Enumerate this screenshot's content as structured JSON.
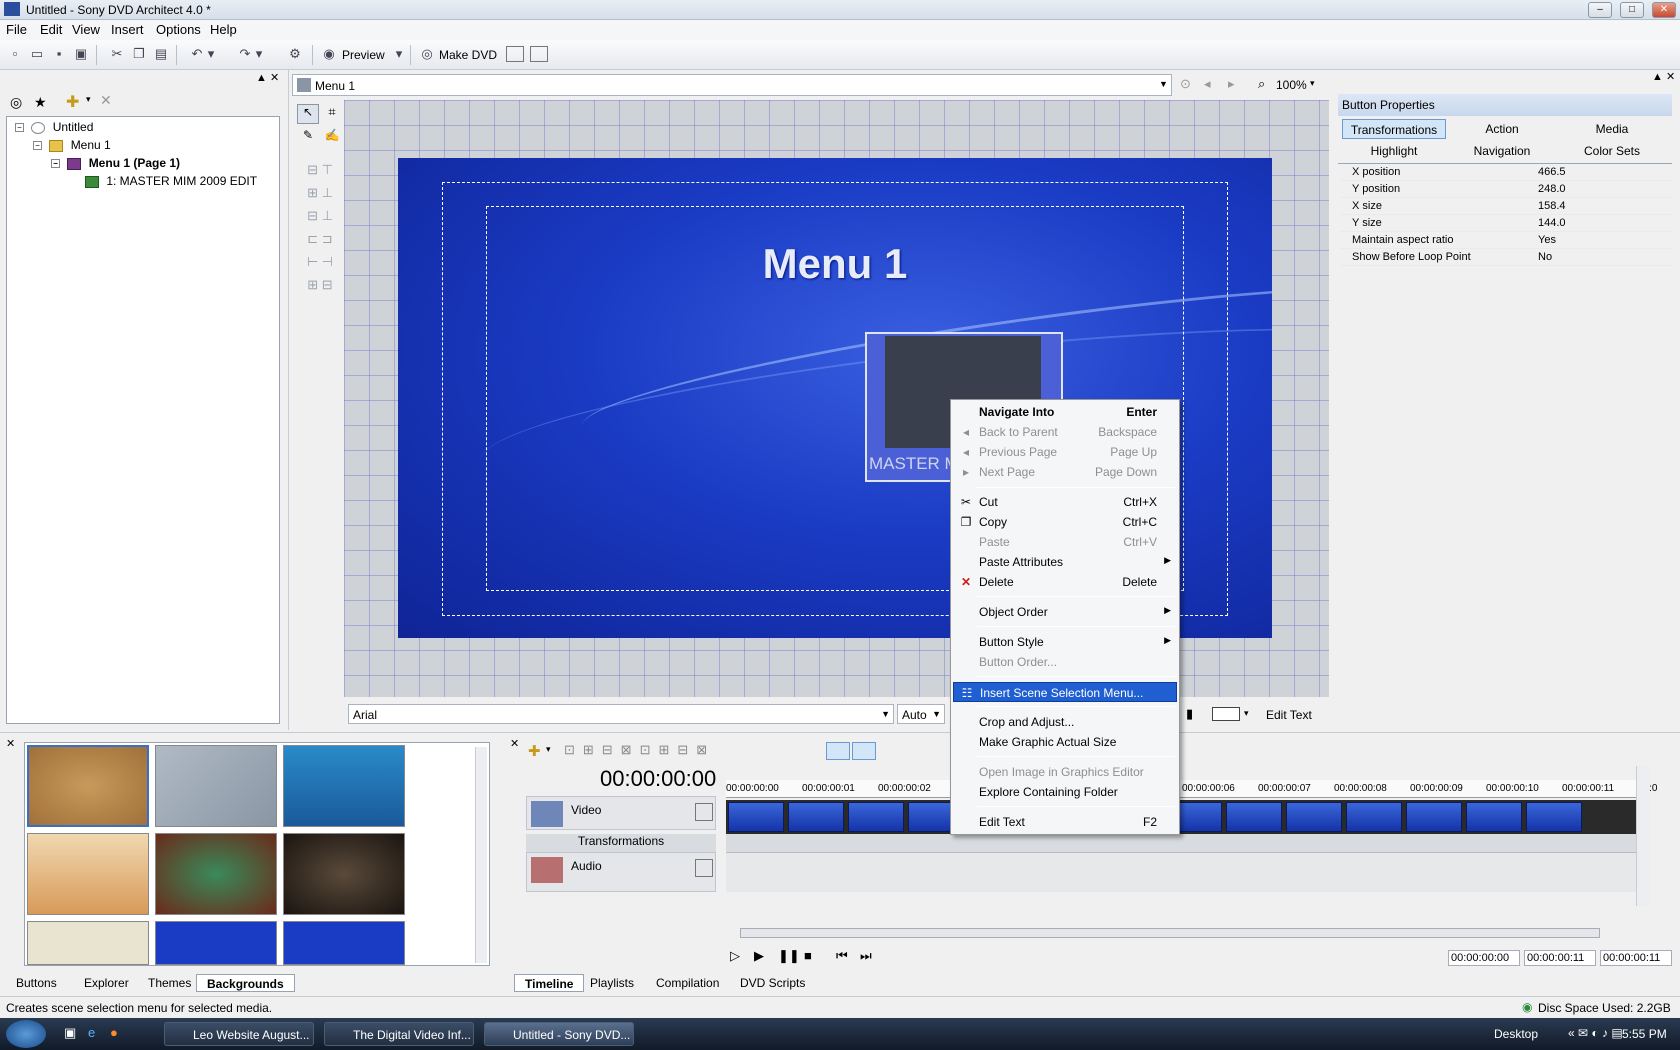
{
  "window": {
    "title": "Untitled - Sony DVD Architect 4.0 *",
    "min": "–",
    "max": "□",
    "close": "✕"
  },
  "menubar": [
    "File",
    "Edit",
    "View",
    "Insert",
    "Options",
    "Help"
  ],
  "toolbar": {
    "preview_label": "Preview",
    "make_dvd_label": "Make DVD"
  },
  "project_tree": {
    "root": "Untitled",
    "menu": "Menu 1",
    "page": "Menu 1 (Page 1)",
    "item": "1: MASTER MIM 2009 EDIT"
  },
  "canvas": {
    "menu_selector": "Menu 1",
    "zoom": "100%",
    "menu_title": "Menu 1",
    "button_label": "MASTER M",
    "font_name": "Arial",
    "font_size": "Auto",
    "edit_text_label": "Edit Text"
  },
  "button_properties": {
    "header": "Button Properties",
    "tabs_row1": [
      "Transformations",
      "Action",
      "Media"
    ],
    "tabs_row2": [
      "Highlight",
      "Navigation",
      "Color Sets"
    ],
    "rows": [
      {
        "name": "X position",
        "value": "466.5"
      },
      {
        "name": "Y position",
        "value": "248.0"
      },
      {
        "name": "X size",
        "value": "158.4"
      },
      {
        "name": "Y size",
        "value": "144.0"
      },
      {
        "name": "Maintain aspect ratio",
        "value": "Yes"
      },
      {
        "name": "Show Before Loop Point",
        "value": "No"
      }
    ]
  },
  "context_menu": {
    "items": [
      {
        "label": "Navigate Into",
        "shortcut": "Enter",
        "disabled": false,
        "bold": true
      },
      {
        "label": "Back to Parent",
        "shortcut": "Backspace",
        "disabled": true
      },
      {
        "label": "Previous Page",
        "shortcut": "Page Up",
        "disabled": true
      },
      {
        "label": "Next Page",
        "shortcut": "Page Down",
        "disabled": true
      },
      {
        "label": "Cut",
        "shortcut": "Ctrl+X",
        "disabled": false
      },
      {
        "label": "Copy",
        "shortcut": "Ctrl+C",
        "disabled": false
      },
      {
        "label": "Paste",
        "shortcut": "Ctrl+V",
        "disabled": true
      },
      {
        "label": "Paste Attributes",
        "shortcut": "",
        "disabled": false
      },
      {
        "label": "Delete",
        "shortcut": "Delete",
        "disabled": false
      },
      {
        "label": "Object Order",
        "shortcut": "",
        "disabled": false
      },
      {
        "label": "Button Style",
        "shortcut": "",
        "disabled": false
      },
      {
        "label": "Button Order...",
        "shortcut": "",
        "disabled": true
      },
      {
        "label": "Insert Scene Selection Menu...",
        "shortcut": "",
        "disabled": false
      },
      {
        "label": "Crop and Adjust...",
        "shortcut": "",
        "disabled": false
      },
      {
        "label": "Make Graphic Actual Size",
        "shortcut": "",
        "disabled": false
      },
      {
        "label": "Open Image in Graphics Editor",
        "shortcut": "",
        "disabled": true
      },
      {
        "label": "Explore Containing Folder",
        "shortcut": "",
        "disabled": false
      },
      {
        "label": "Edit Text",
        "shortcut": "F2",
        "disabled": false
      }
    ]
  },
  "bottom_tabs": [
    "Buttons",
    "Explorer",
    "Themes",
    "Backgrounds"
  ],
  "timeline": {
    "timecode": "00:00:00:00",
    "video_track": "Video",
    "transformations": "Transformations",
    "audio_track": "Audio",
    "ruler": [
      "00:00:00:00",
      "00:00:00:01",
      "00:00:00:02",
      "00:00:00:06",
      "00:00:00:07",
      "00:00:00:08",
      "00:00:00:09",
      "00:00:00:10",
      "00:00:00:11",
      "00:0"
    ],
    "time_start": "00:00:00:00",
    "time_end": "00:00:00:11",
    "time_length": "00:00:00:11",
    "tabs": [
      "Timeline",
      "Playlists",
      "Compilation",
      "DVD Scripts"
    ]
  },
  "status": {
    "message": "Creates scene selection menu for selected media.",
    "disc_space": "Disc Space Used: 2.2GB"
  },
  "taskbar": {
    "tasks": [
      "Leo Website August...",
      "The Digital Video Inf...",
      "Untitled - Sony DVD..."
    ],
    "desktop": "Desktop",
    "clock": "5:55 PM"
  },
  "colors": {
    "accent": "#1f5fd1",
    "menu_bg": "#1a3bc4"
  }
}
